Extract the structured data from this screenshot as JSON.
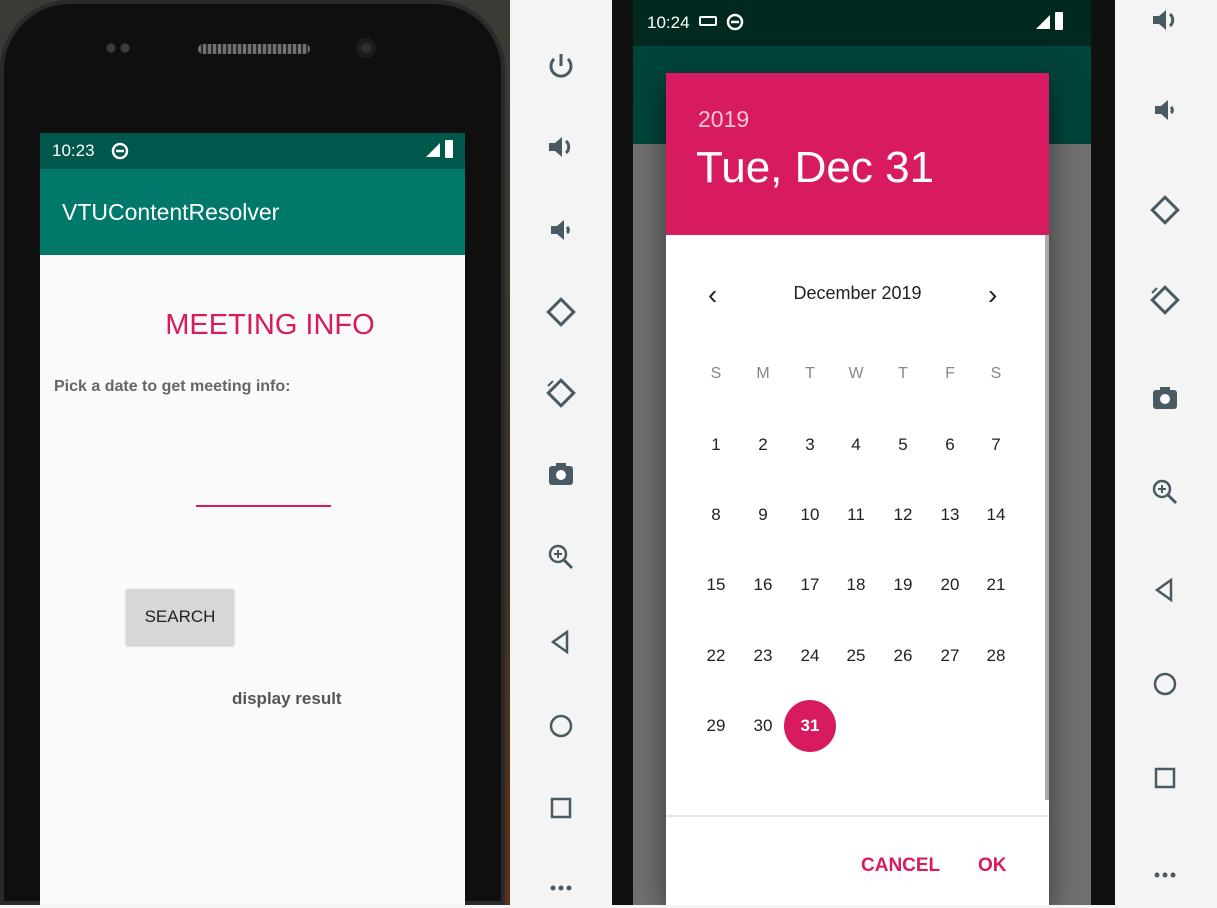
{
  "left_screen": {
    "status_time": "10:23",
    "app_title": "VTUContentResolver",
    "heading": "MEETING INFO",
    "prompt": "Pick a date to get meeting info:",
    "search_label": "SEARCH",
    "result_label": "display result"
  },
  "right_screen": {
    "status_time": "10:24",
    "dialog": {
      "year": "2019",
      "selected_date": "Tue, Dec 31",
      "month": "December 2019",
      "weekdays": [
        "S",
        "M",
        "T",
        "W",
        "T",
        "F",
        "S"
      ],
      "days": [
        "1",
        "2",
        "3",
        "4",
        "5",
        "6",
        "7",
        "8",
        "9",
        "10",
        "11",
        "12",
        "13",
        "14",
        "15",
        "16",
        "17",
        "18",
        "19",
        "20",
        "21",
        "22",
        "23",
        "24",
        "25",
        "26",
        "27",
        "28",
        "29",
        "30",
        "31"
      ],
      "cancel_label": "CANCEL",
      "ok_label": "OK"
    }
  },
  "emulator_controls": {
    "buttons": [
      "power-icon",
      "volume-up-icon",
      "volume-down-icon",
      "rotate-left-icon",
      "rotate-right-icon",
      "camera-icon",
      "zoom-icon",
      "back-icon",
      "home-icon",
      "overview-icon",
      "more-icon"
    ]
  },
  "colors": {
    "accent": "#d81b60",
    "primary": "#00796b",
    "primary_dark": "#00574b"
  }
}
